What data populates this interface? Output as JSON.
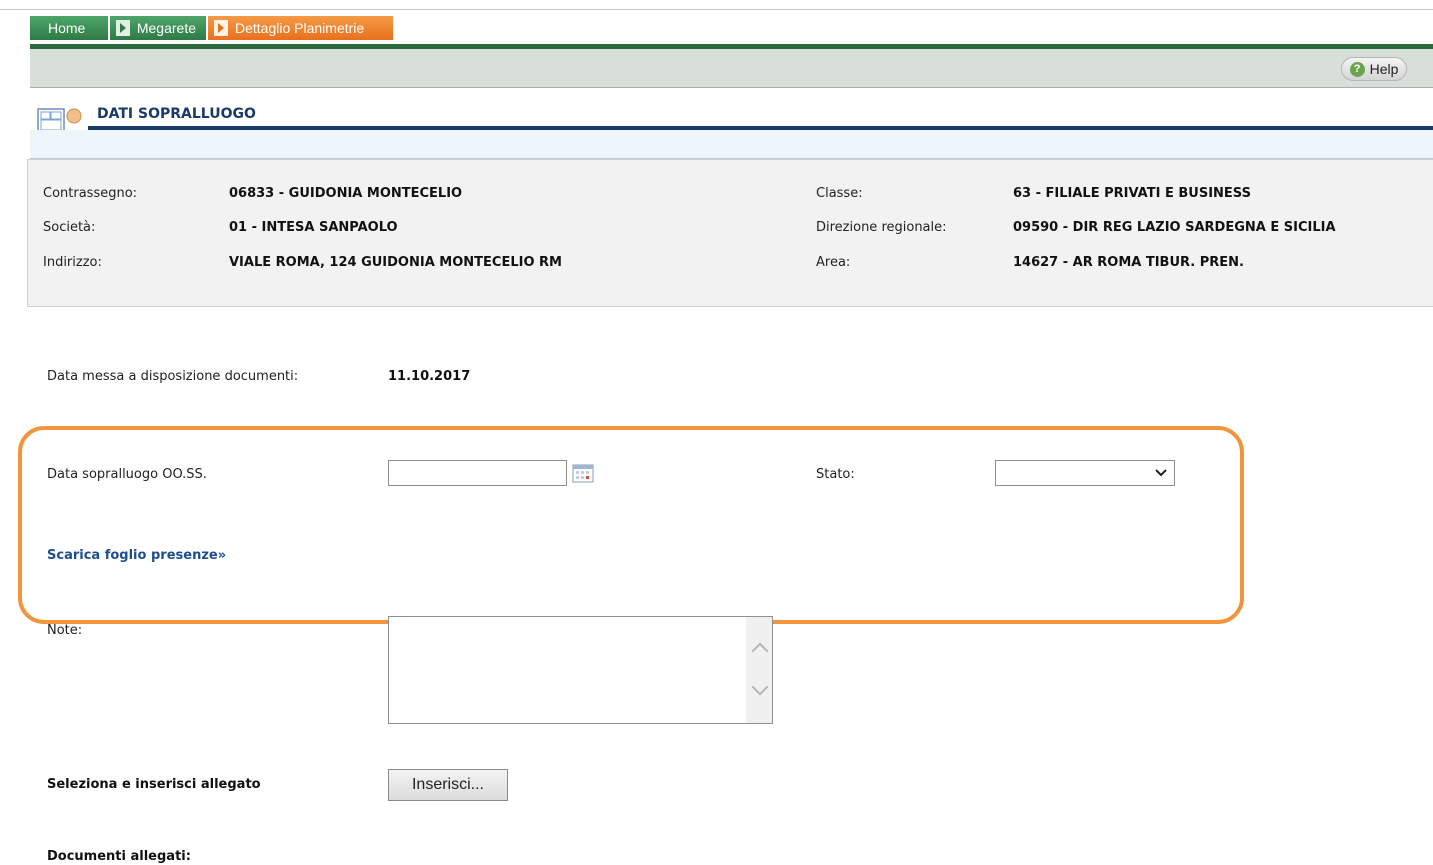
{
  "breadcrumb": [
    "Home",
    "Megarete",
    "Dettaglio Planimetrie"
  ],
  "toolbar": {
    "help_label": "Help"
  },
  "section": {
    "title": "DATI SOPRALLUOGO"
  },
  "info": {
    "left": [
      {
        "label": "Contrassegno:",
        "value": "06833 - GUIDONIA MONTECELIO"
      },
      {
        "label": "Società:",
        "value": "01 - INTESA SANPAOLO"
      },
      {
        "label": "Indirizzo:",
        "value": "VIALE ROMA, 124 GUIDONIA MONTECELIO RM"
      }
    ],
    "right": [
      {
        "label": "Classe:",
        "value": "63 - FILIALE PRIVATI E BUSINESS"
      },
      {
        "label": "Direzione regionale:",
        "value": "09590 - DIR REG LAZIO SARDEGNA E SICILIA"
      },
      {
        "label": "Area:",
        "value": "14627 - AR ROMA TIBUR. PREN."
      }
    ]
  },
  "form": {
    "docs_date_label": "Data messa a disposizione documenti:",
    "docs_date_value": "11.10.2017",
    "survey_date_label": "Data sopralluogo OO.SS.",
    "survey_date_value": "",
    "stato_label": "Stato:",
    "stato_value": "",
    "download_link": "Scarica foglio presenze»",
    "note_label": "Note:",
    "note_value": "",
    "attach_label": "Seleziona e inserisci allegato",
    "attach_button": "Inserisci...",
    "attached_docs_label": "Documenti allegati:"
  },
  "colors": {
    "accent_orange": "#f0953c",
    "nav_green": "#2e7a45",
    "title_blue": "#1a3a6a"
  }
}
